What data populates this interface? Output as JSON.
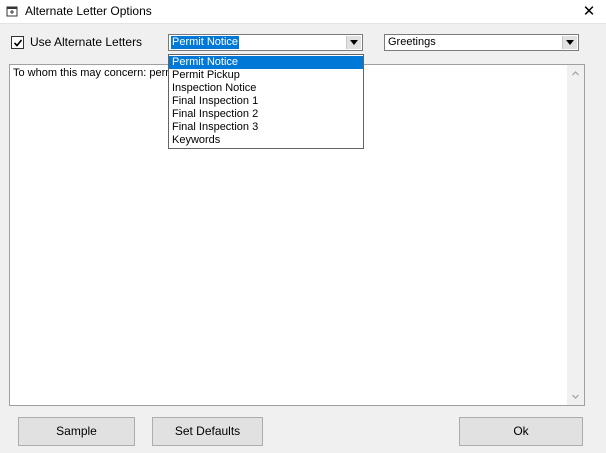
{
  "window": {
    "title": "Alternate Letter Options",
    "close_glyph": "✕",
    "icon": "window-icon"
  },
  "options": {
    "use_alternate_label": "Use Alternate Letters",
    "use_alternate_checked": true
  },
  "letter_combo": {
    "value": "Permit Notice",
    "items": [
      "Permit Notice",
      "Permit Pickup",
      "Inspection Notice",
      "Final Inspection 1",
      "Final Inspection 2",
      "Final Inspection 3",
      "Keywords"
    ],
    "selected_index": 0
  },
  "section_combo": {
    "value": "Greetings"
  },
  "body_text": {
    "visible_text": "To whom this may concern: perm"
  },
  "buttons": {
    "sample": "Sample",
    "set_defaults": "Set Defaults",
    "ok": "Ok"
  },
  "colors": {
    "selection": "#0078d7",
    "window_bg": "#f0f0f0",
    "button_bg": "#e1e1e1"
  }
}
